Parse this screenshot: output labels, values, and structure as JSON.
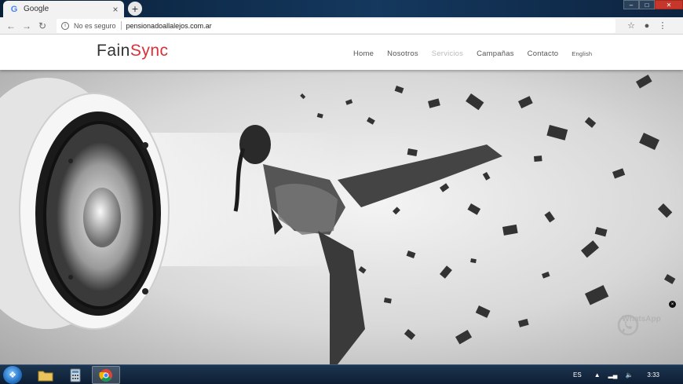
{
  "browser": {
    "tab_title": "Google",
    "favicon_letter": "G",
    "tab_close": "×",
    "new_tab": "+",
    "security_label": "No es seguro",
    "url": "pensionadoallalejos.com.ar",
    "window_controls": [
      "–",
      "□",
      "✕"
    ]
  },
  "site": {
    "logo_part1": "Fain",
    "logo_part2": "Sync",
    "logo_accent_color": "#d9303a",
    "nav": [
      {
        "label": "Home",
        "active": false
      },
      {
        "label": "Nosotros",
        "active": false
      },
      {
        "label": "Servicios",
        "active": true
      },
      {
        "label": "Campañas",
        "active": false
      },
      {
        "label": "Contacto",
        "active": false
      },
      {
        "label": "English",
        "active": false
      }
    ],
    "whatsapp_label": "WhatsApp",
    "whatsapp_icon": "whatsapp-icon",
    "close_icon": "×"
  },
  "taskbar": {
    "language": "ES",
    "clock": "3:33",
    "apps": [
      "windows-explorer",
      "calculator",
      "chrome"
    ]
  }
}
